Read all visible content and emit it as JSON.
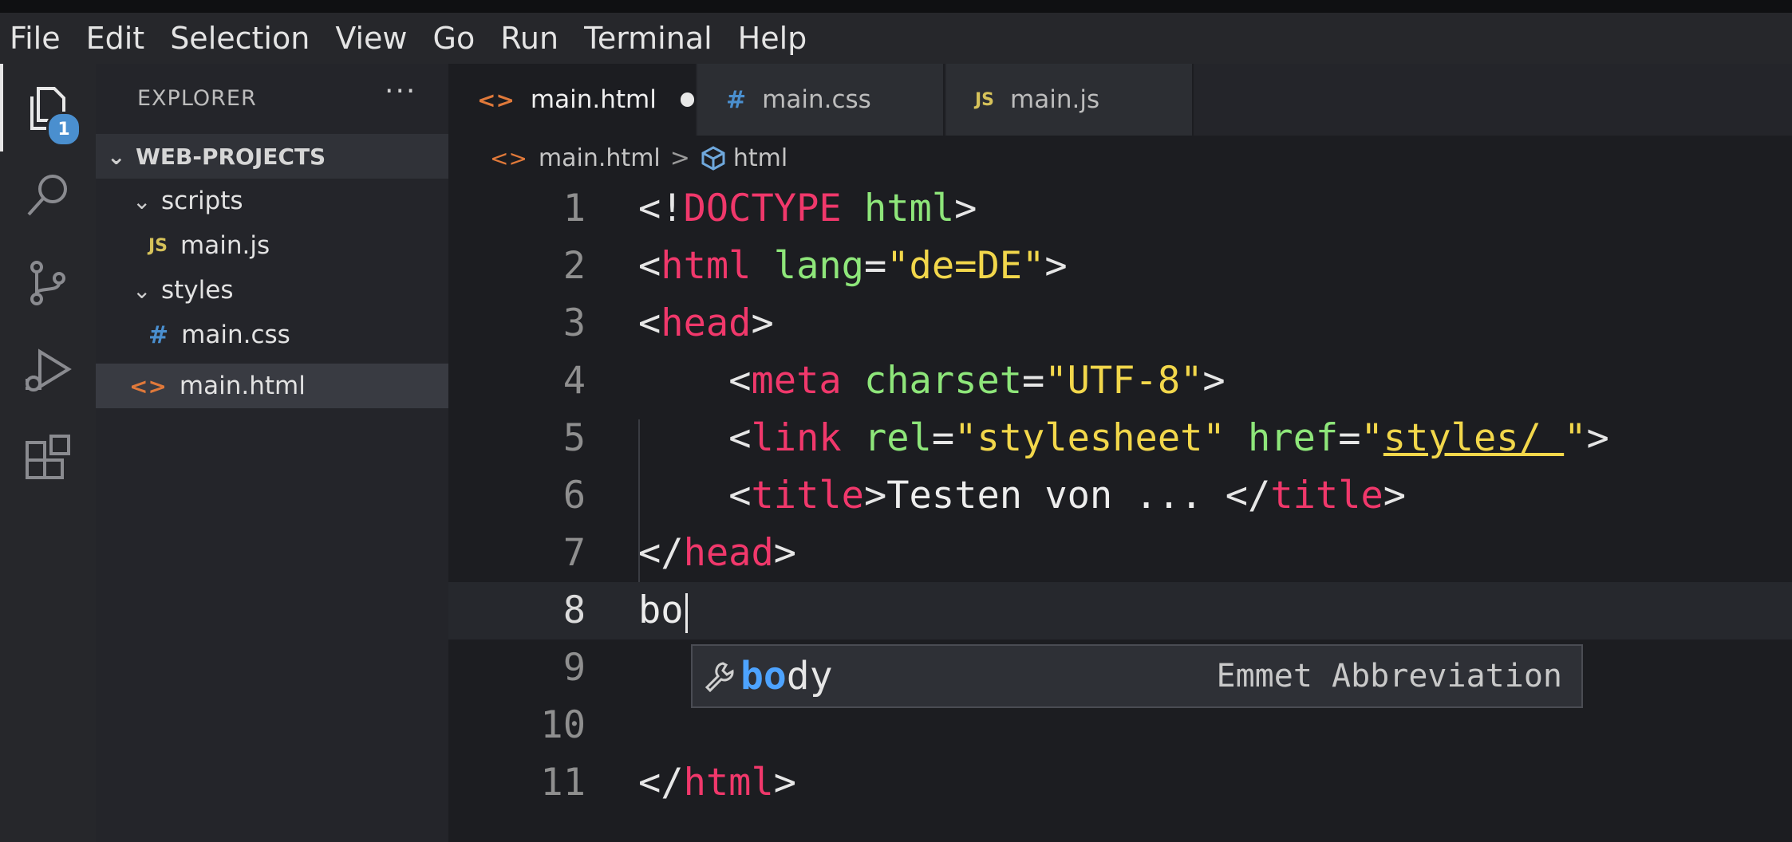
{
  "menubar": {
    "items": [
      "File",
      "Edit",
      "Selection",
      "View",
      "Go",
      "Run",
      "Terminal",
      "Help"
    ]
  },
  "activitybar": {
    "icons": [
      "files-icon",
      "search-icon",
      "source-control-icon",
      "run-debug-icon",
      "extensions-icon"
    ],
    "badge": "1"
  },
  "sidebar": {
    "title": "EXPLORER",
    "more": "···",
    "project": "WEB-PROJECTS",
    "tree": [
      {
        "label": "scripts",
        "type": "folder"
      },
      {
        "label": "main.js",
        "type": "js"
      },
      {
        "label": "styles",
        "type": "folder"
      },
      {
        "label": "main.css",
        "type": "css"
      },
      {
        "label": "main.html",
        "type": "html",
        "selected": true
      }
    ]
  },
  "tabs": [
    {
      "label": "main.html",
      "icon": "<>",
      "active": true,
      "dirty": true
    },
    {
      "label": "main.css",
      "icon": "#",
      "active": false
    },
    {
      "label": "main.js",
      "icon": "JS",
      "active": false
    }
  ],
  "breadcrumb": {
    "file": "main.html",
    "separator": ">",
    "symbol": "html"
  },
  "editor": {
    "line_numbers": [
      "1",
      "2",
      "3",
      "4",
      "5",
      "6",
      "7",
      "8",
      "9",
      "10",
      "11"
    ],
    "current_line": "8",
    "typed": "bo"
  },
  "suggestion": {
    "match": "bo",
    "rest": "dy",
    "detail": "Emmet Abbreviation"
  },
  "colors": {
    "tag": "#f0386b",
    "attribute": "#8ee67a",
    "string": "#f2d74b",
    "match": "#4da3ff"
  }
}
